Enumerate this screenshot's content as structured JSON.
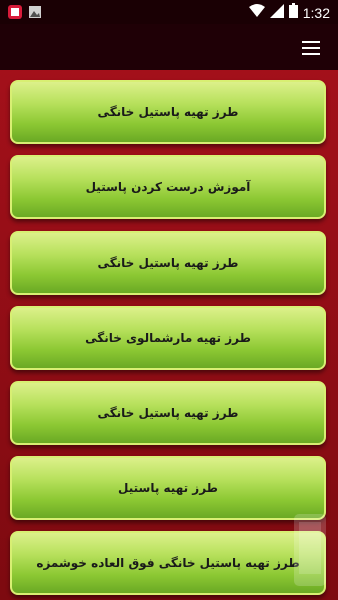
{
  "status_bar": {
    "time": "1:32",
    "icons": [
      "app-notification-icon",
      "image-icon",
      "wifi-icon",
      "signal-icon",
      "battery-icon"
    ]
  },
  "app_bar": {
    "menu_icon": "hamburger-menu-icon"
  },
  "items": [
    {
      "label": "طرز تهیه پاستیل خانگی"
    },
    {
      "label": "آموزش درست کردن پاستیل"
    },
    {
      "label": "طرز تهیه پاستیل خانگی"
    },
    {
      "label": "طرز تهیه مارشمالوی خانگی"
    },
    {
      "label": "طرز تهیه پاستیل خانگی"
    },
    {
      "label": "طرز تهیه پاستیل"
    },
    {
      "label": "طرز تهیه پاستیل خانگی فوق العاده خوشمزه"
    }
  ],
  "colors": {
    "background": "#8e0a10",
    "item_top": "#dcf08a",
    "item_bottom": "#6aa924",
    "app_bar": "#1f0006"
  }
}
